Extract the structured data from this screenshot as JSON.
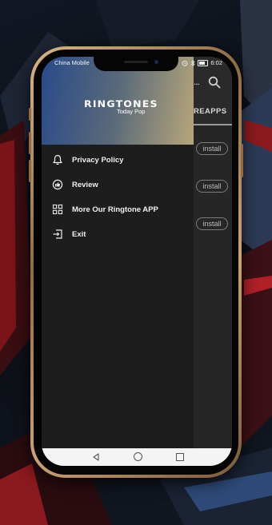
{
  "status_bar": {
    "carrier": "China Mobile",
    "time": "6:02",
    "icons": [
      "alarm-icon",
      "bluetooth-icon",
      "battery-icon"
    ]
  },
  "app": {
    "overflow_glyph": "...",
    "tab_label": "REAPPS",
    "install_buttons": [
      "install",
      "install",
      "install"
    ],
    "icons": [
      "search-icon"
    ]
  },
  "drawer": {
    "logo_title": "RINGTONES",
    "logo_subtitle": "Today Pop",
    "items": [
      {
        "label": "Privacy Policy",
        "icon": "bell-icon"
      },
      {
        "label": "Review",
        "icon": "review-badge-icon"
      },
      {
        "label": "More Our Ringtone APP",
        "icon": "grid-icon"
      },
      {
        "label": "Exit",
        "icon": "exit-icon"
      }
    ]
  },
  "nav_bar": {
    "icons": [
      "back-icon",
      "home-icon",
      "recents-icon"
    ]
  },
  "colors": {
    "drawer_bg": "#1d1d1d",
    "header_gradient_start": "#2a4a8a",
    "header_gradient_end": "#b8a67a",
    "phone_frame": "#c9a27a"
  }
}
